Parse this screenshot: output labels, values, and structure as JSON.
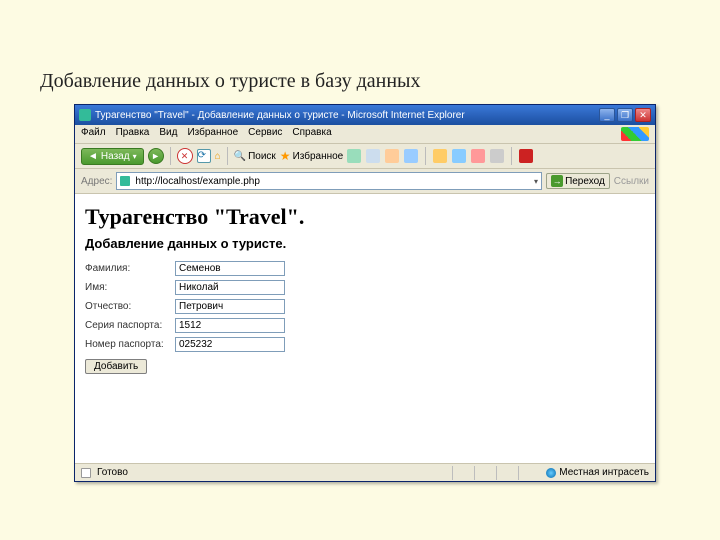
{
  "slide": {
    "title": "Добавление данных о туристе в базу данных"
  },
  "window": {
    "title": "Турагенство \"Travel\" - Добавление данных о туристе - Microsoft Internet Explorer"
  },
  "menu": {
    "file": "Файл",
    "edit": "Правка",
    "view": "Вид",
    "favorites": "Избранное",
    "tools": "Сервис",
    "help": "Справка"
  },
  "toolbar": {
    "back": "Назад",
    "search": "Поиск",
    "favorites": "Избранное"
  },
  "address": {
    "label": "Адрес:",
    "url": "http://localhost/example.php",
    "go": "Переход",
    "links": "Ссылки"
  },
  "page": {
    "h1": "Турагенство \"Travel\".",
    "h2": "Добавление данных о туристе.",
    "fields": {
      "lastname": {
        "label": "Фамилия:",
        "value": "Семенов"
      },
      "firstname": {
        "label": "Имя:",
        "value": "Николай"
      },
      "patronymic": {
        "label": "Отчество:",
        "value": "Петрович"
      },
      "passport_series": {
        "label": "Серия паспорта:",
        "value": "1512"
      },
      "passport_number": {
        "label": "Номер паспорта:",
        "value": "025232"
      }
    },
    "submit": "Добавить"
  },
  "status": {
    "ready": "Готово",
    "zone": "Местная интрасеть"
  }
}
